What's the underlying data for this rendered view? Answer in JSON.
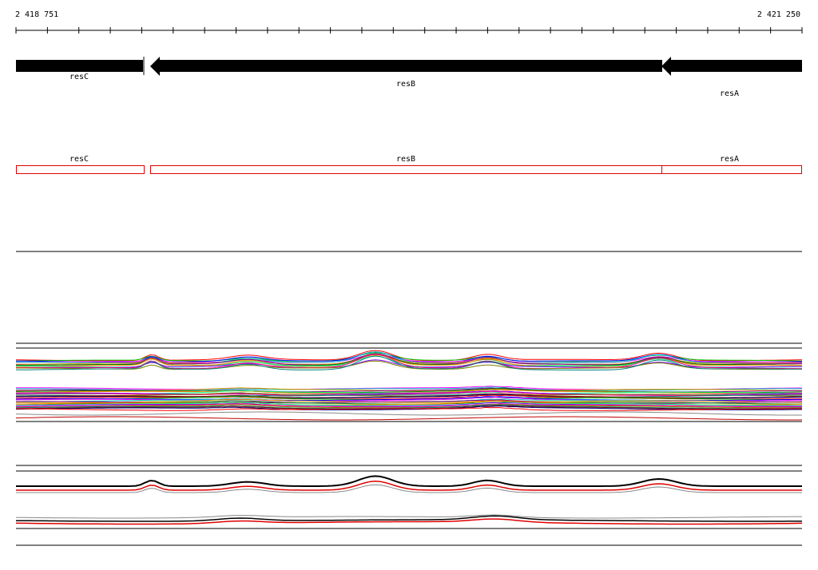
{
  "ruler": {
    "start_label": "2 418 751",
    "end_label": "2 421 250",
    "start": 2418751,
    "end": 2421250
  },
  "genes": [
    {
      "name": "resC",
      "strand": "+"
    },
    {
      "name": "resB",
      "strand": "-"
    },
    {
      "name": "resA",
      "strand": "-"
    }
  ],
  "cds_labels": [
    "resC",
    "resB",
    "resA"
  ],
  "colors": {
    "gene_arrow": "#000000",
    "cds_box": "#e00000",
    "track_line": "#000000",
    "lower_black": "#000000",
    "lower_red": "#e00000",
    "lower_gray": "#888888"
  },
  "palette": [
    "#ff0000",
    "#00c000",
    "#0000ff",
    "#ff00ff",
    "#00c0c0",
    "#e0a000",
    "#800080",
    "#008000",
    "#ff8000",
    "#00ff80",
    "#8000ff",
    "#ff0080",
    "#808000",
    "#008080",
    "#800000",
    "#000080"
  ]
}
